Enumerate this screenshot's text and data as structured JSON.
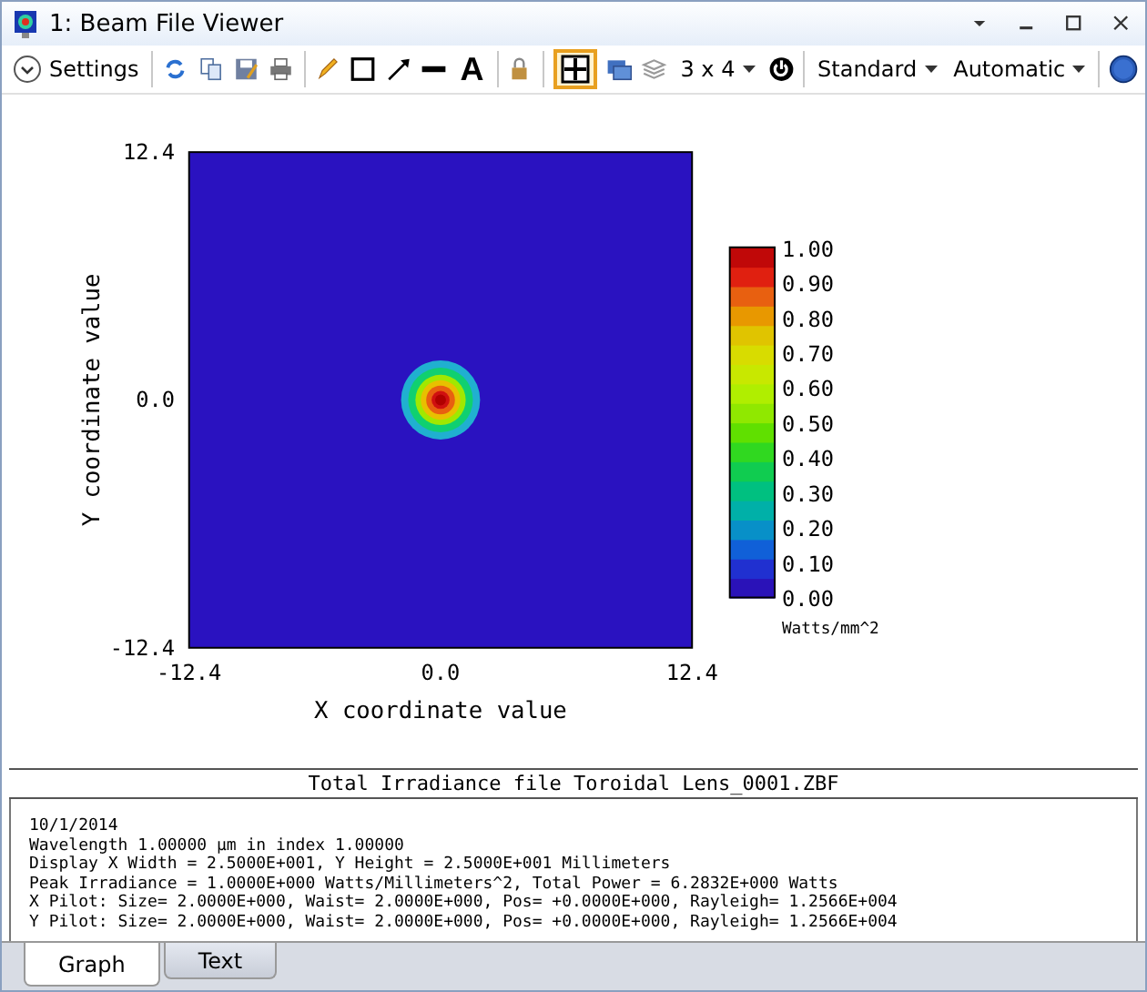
{
  "window": {
    "title": "1: Beam File Viewer"
  },
  "toolbar": {
    "settings_label": "Settings",
    "text_tool_label": "A",
    "grid_tool_selected": true,
    "layout_dropdown": "3 x 4",
    "dropdowns": [
      "Standard",
      "Automatic"
    ]
  },
  "plot": {
    "y_ticks": [
      "12.4",
      "0.0",
      "-12.4"
    ],
    "x_ticks": [
      "-12.4",
      "0.0",
      "12.4"
    ],
    "x_label": "X coordinate value",
    "y_label": "Y coordinate value",
    "colorbar": {
      "ticks": [
        "1.00",
        "0.90",
        "0.80",
        "0.70",
        "0.60",
        "0.50",
        "0.40",
        "0.30",
        "0.20",
        "0.10",
        "0.00"
      ],
      "unit": "Watts/mm^2"
    }
  },
  "report": {
    "title": "Total Irradiance file Toroidal Lens_0001.ZBF",
    "lines": [
      "10/1/2014",
      "Wavelength 1.00000 µm in index 1.00000",
      "Display X Width = 2.5000E+001, Y Height = 2.5000E+001 Millimeters",
      "Peak Irradiance = 1.0000E+000 Watts/Millimeters^2, Total Power = 6.2832E+000 Watts",
      "X Pilot: Size= 2.0000E+000, Waist= 2.0000E+000, Pos= +0.0000E+000, Rayleigh= 1.2566E+004",
      "Y Pilot: Size= 2.0000E+000, Waist= 2.0000E+000, Pos= +0.0000E+000, Rayleigh= 1.2566E+004"
    ]
  },
  "tabs": [
    {
      "label": "Graph",
      "selected": true
    },
    {
      "label": "Text",
      "selected": false
    }
  ]
}
